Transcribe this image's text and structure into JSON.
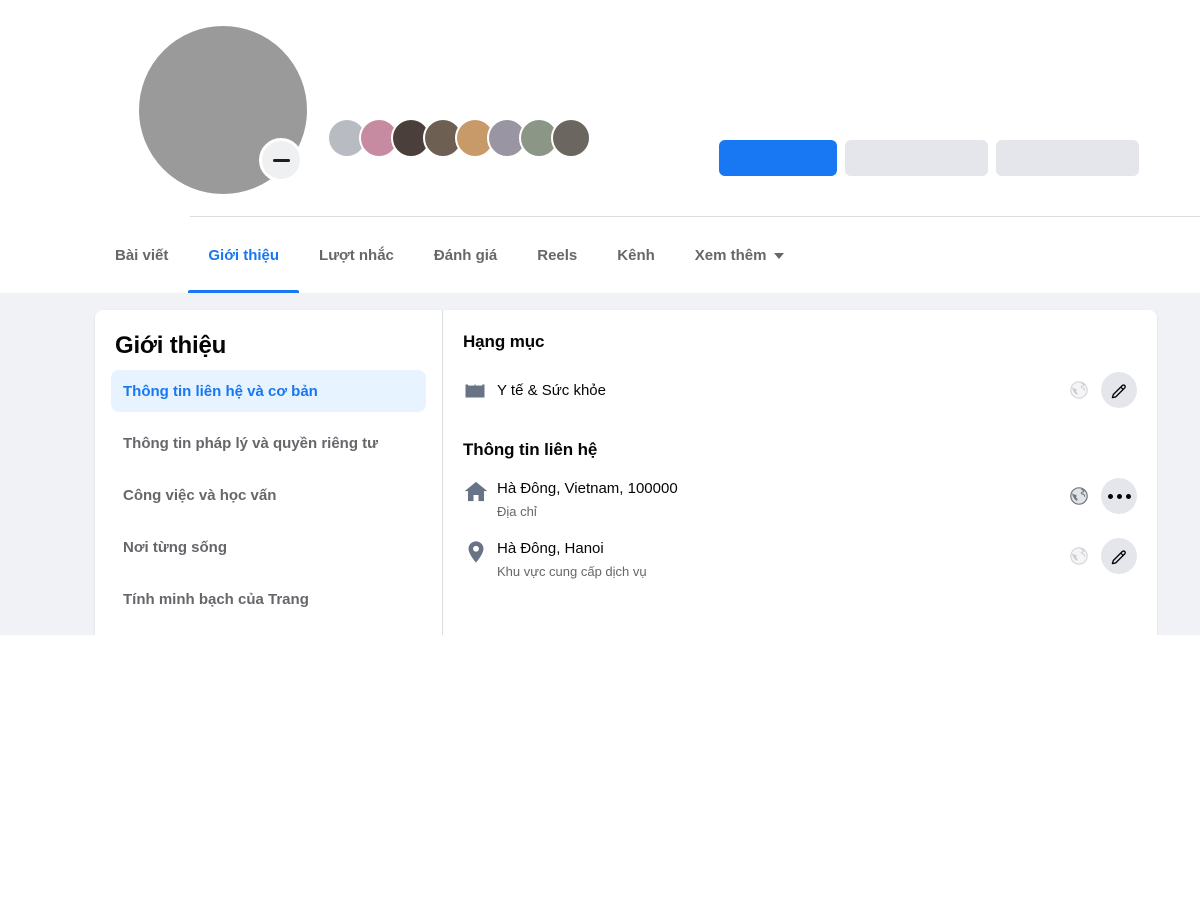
{
  "header": {
    "avatar_name": "profile-avatar",
    "camera_badge": "camera-badge",
    "friends_count": 8,
    "buttons": [
      {
        "label": "",
        "style": "primary",
        "name": "promote-button"
      },
      {
        "label": "",
        "style": "secondary",
        "name": "message-button"
      },
      {
        "label": "",
        "style": "secondary",
        "name": "more-actions-button"
      }
    ]
  },
  "tabs": [
    {
      "label": "Bài viết",
      "active": false
    },
    {
      "label": "Giới thiệu",
      "active": true
    },
    {
      "label": "Lượt nhắc",
      "active": false
    },
    {
      "label": "Đánh giá",
      "active": false
    },
    {
      "label": "Reels",
      "active": false
    },
    {
      "label": "Kênh",
      "active": false
    },
    {
      "label": "Xem thêm",
      "active": false,
      "caret": true
    }
  ],
  "tabs_more_label": "...",
  "about": {
    "title": "Giới thiệu",
    "menu": [
      {
        "label": "Thông tin liên hệ và cơ bản",
        "active": true
      },
      {
        "label": "Thông tin pháp lý và quyền riêng tư",
        "active": false
      },
      {
        "label": "Công việc và học vấn",
        "active": false
      },
      {
        "label": "Nơi từng sống",
        "active": false
      },
      {
        "label": "Tính minh bạch của Trang",
        "active": false
      }
    ],
    "category_section": {
      "title": "Hạng mục",
      "rows": [
        {
          "icon": "folder-icon",
          "main": "Y tế & Sức khỏe",
          "sub": "",
          "privacy": "public-globe-icon",
          "action": "edit-pencil-icon"
        }
      ]
    },
    "contact_section": {
      "title": "Thông tin liên hệ",
      "rows": [
        {
          "icon": "house-icon",
          "main": "Hà Đông, Vietnam, 100000",
          "sub": "Địa chỉ",
          "privacy": "public-globe-icon",
          "action": "more-dots-icon"
        },
        {
          "icon": "map-pin-icon",
          "main": "Hà Đông, Hanoi",
          "sub": "Khu vực cung cấp dịch vụ",
          "privacy": "public-globe-icon",
          "action": "edit-pencil-icon"
        }
      ]
    }
  },
  "colors": {
    "accent": "#1877f2",
    "canvas": "#f0f2f5",
    "card": "#ffffff",
    "active_menu_bg": "#e7f3ff",
    "secondary_text": "#65676b",
    "primary_text": "#050505",
    "button_grey": "#e4e6eb",
    "icon_slate": "#697386"
  }
}
